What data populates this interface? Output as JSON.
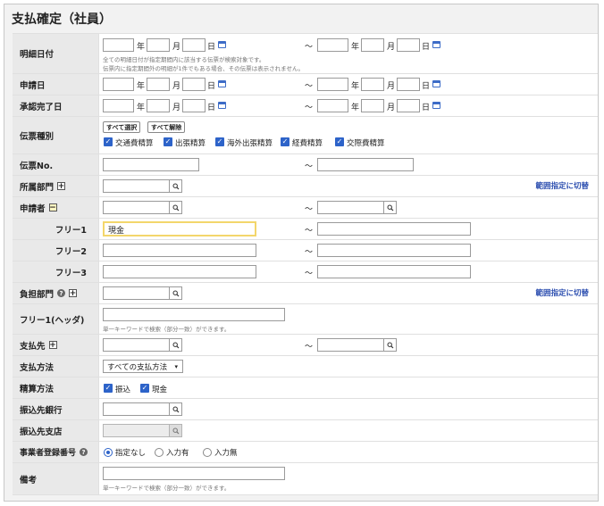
{
  "page": {
    "title": "支払確定（社員）"
  },
  "units": {
    "year": "年",
    "month": "月",
    "day": "日",
    "tilde": "～"
  },
  "rows": {
    "detail_date": {
      "label": "明細日付",
      "note1": "全ての明細日付が指定期間内に該当する伝票が検索対象です。",
      "note2": "伝票内に指定期間外の明細が1件でもある場合、その伝票は表示されません。"
    },
    "apply_date": {
      "label": "申請日"
    },
    "approval_date": {
      "label": "承認完了日"
    },
    "slip_type": {
      "label": "伝票種別",
      "select_all": "すべて選択",
      "clear_all": "すべて解除",
      "options": [
        "交通費精算",
        "出張精算",
        "海外出張精算",
        "経費精算",
        "交際費精算"
      ]
    },
    "slip_no": {
      "label": "伝票No."
    },
    "department": {
      "label": "所属部門",
      "toggle": "+",
      "range_link": "範囲指定に切替"
    },
    "applicant": {
      "label": "申請者",
      "toggle": "−"
    },
    "free1": {
      "label": "フリー1",
      "value": "現金"
    },
    "free2": {
      "label": "フリー2"
    },
    "free3": {
      "label": "フリー3"
    },
    "burden_dept": {
      "label": "負担部門",
      "toggle": "+",
      "range_link": "範囲指定に切替"
    },
    "free1_header": {
      "label": "フリー1(ヘッダ)",
      "note": "単一キーワードで検索（部分一致）ができます。"
    },
    "payee": {
      "label": "支払先",
      "toggle": "+"
    },
    "pay_method": {
      "label": "支払方法",
      "selected": "すべての支払方法"
    },
    "settle_method": {
      "label": "精算方法",
      "options": [
        "振込",
        "現金"
      ]
    },
    "bank": {
      "label": "振込先銀行"
    },
    "branch": {
      "label": "振込先支店"
    },
    "business_reg": {
      "label": "事業者登録番号",
      "options": [
        "指定なし",
        "入力有",
        "入力無"
      ],
      "selected": "指定なし"
    },
    "remarks": {
      "label": "備考",
      "note": "単一キーワードで検索（部分一致）ができます。"
    }
  },
  "icons": {
    "calendar": "calendar-icon",
    "search": "search-icon",
    "check": "check-icon",
    "help": "help-icon",
    "caret": "caret-down-icon"
  },
  "colors": {
    "accent": "#2d63c9",
    "link": "#2d4fb0",
    "focus": "#f3d66b"
  }
}
